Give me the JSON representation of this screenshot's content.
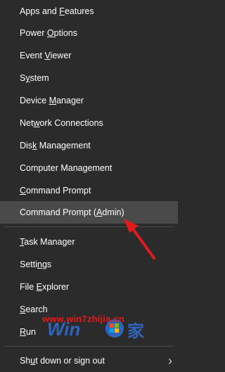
{
  "menu": {
    "items": [
      {
        "pre": "Apps and ",
        "u": "F",
        "post": "eatures"
      },
      {
        "pre": "Power ",
        "u": "O",
        "post": "ptions"
      },
      {
        "pre": "Event ",
        "u": "V",
        "post": "iewer"
      },
      {
        "pre": "S",
        "u": "y",
        "post": "stem"
      },
      {
        "pre": "Device ",
        "u": "M",
        "post": "anager"
      },
      {
        "pre": "Net",
        "u": "w",
        "post": "ork Connections"
      },
      {
        "pre": "Dis",
        "u": "k",
        "post": " Management"
      },
      {
        "pre": "Computer Mana",
        "u": "g",
        "post": "ement"
      },
      {
        "pre": "",
        "u": "C",
        "post": "ommand Prompt"
      },
      {
        "pre": "Command Prompt (",
        "u": "A",
        "post": "dmin)"
      },
      {
        "pre": "",
        "u": "T",
        "post": "ask Manager"
      },
      {
        "pre": "Setti",
        "u": "n",
        "post": "gs"
      },
      {
        "pre": "File ",
        "u": "E",
        "post": "xplorer"
      },
      {
        "pre": "",
        "u": "S",
        "post": "earch"
      },
      {
        "pre": "",
        "u": "R",
        "post": "un"
      },
      {
        "pre": "Sh",
        "u": "u",
        "post": "t down or sign out"
      }
    ]
  },
  "watermark": {
    "text": "www.win7zhijia.cn"
  },
  "colors": {
    "background": "#2b2b2b",
    "highlight": "#4a4a4a",
    "arrow": "#e11b1b",
    "text": "#ffffff"
  }
}
